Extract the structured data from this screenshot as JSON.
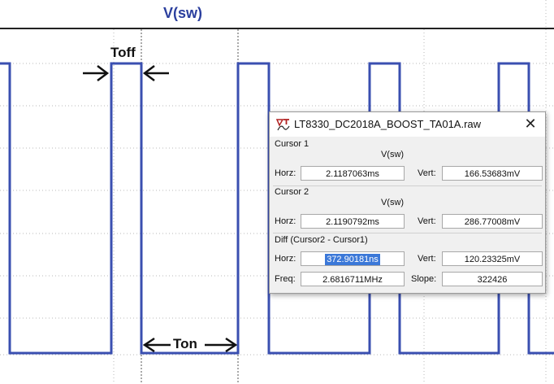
{
  "plot": {
    "trace_name": "V(sw)",
    "annotations": {
      "toff": "Toff",
      "ton": "Ton"
    },
    "trace_color": "#3a4fb0"
  },
  "dialog": {
    "title": "LT8330_DC2018A_BOOST_TA01A.raw",
    "close_glyph": "✕",
    "cursor1": {
      "label": "Cursor 1",
      "trace": "V(sw)",
      "horz_label": "Horz:",
      "horz_value": "2.1187063ms",
      "vert_label": "Vert:",
      "vert_value": "166.53683mV"
    },
    "cursor2": {
      "label": "Cursor 2",
      "trace": "V(sw)",
      "horz_label": "Horz:",
      "horz_value": "2.1190792ms",
      "vert_label": "Vert:",
      "vert_value": "286.77008mV"
    },
    "diff": {
      "label": "Diff (Cursor2 - Cursor1)",
      "horz_label": "Horz:",
      "horz_value": "372.90181ns",
      "vert_label": "Vert:",
      "vert_value": "120.23325mV",
      "freq_label": "Freq:",
      "freq_value": "2.6816711MHz",
      "slope_label": "Slope:",
      "slope_value": "322426"
    }
  }
}
